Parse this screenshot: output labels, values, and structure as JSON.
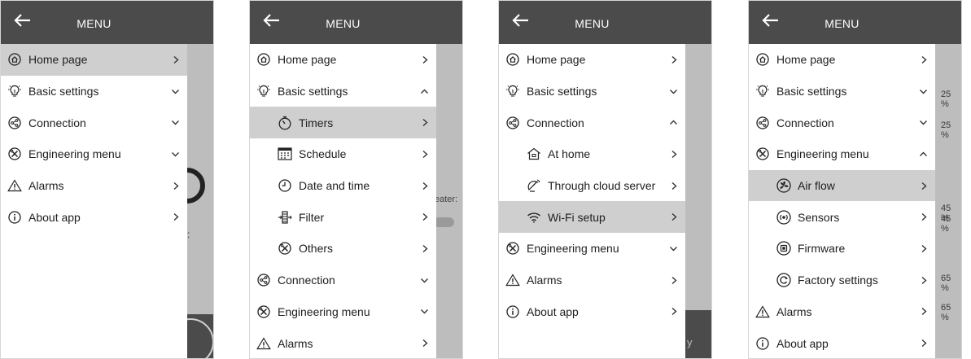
{
  "header": {
    "title": "MENU"
  },
  "panels": [
    {
      "items": [
        {
          "label": "Home page",
          "icon": "home-icon",
          "chev": ">",
          "hl": true
        },
        {
          "label": "Basic settings",
          "icon": "bulb-icon",
          "chev": "v"
        },
        {
          "label": "Connection",
          "icon": "share-icon",
          "chev": "v"
        },
        {
          "label": "Engineering menu",
          "icon": "tools-icon",
          "chev": "v"
        },
        {
          "label": "Alarms",
          "icon": "warning-icon",
          "chev": ">"
        },
        {
          "label": "About app",
          "icon": "info-icon",
          "chev": ">"
        }
      ],
      "behind_text": "r:"
    },
    {
      "items": [
        {
          "label": "Home page",
          "icon": "home-icon",
          "chev": ">"
        },
        {
          "label": "Basic settings",
          "icon": "bulb-icon",
          "chev": "^"
        },
        {
          "label": "Timers",
          "icon": "timer-icon",
          "chev": ">",
          "sub": true,
          "hl": true
        },
        {
          "label": "Schedule",
          "icon": "calendar-icon",
          "chev": ">",
          "sub": true
        },
        {
          "label": "Date and time",
          "icon": "clock-icon",
          "chev": ">",
          "sub": true
        },
        {
          "label": "Filter",
          "icon": "filter-icon",
          "chev": ">",
          "sub": true
        },
        {
          "label": "Others",
          "icon": "tools-icon",
          "chev": ">",
          "sub": true
        },
        {
          "label": "Connection",
          "icon": "share-icon",
          "chev": "v"
        },
        {
          "label": "Engineering menu",
          "icon": "tools-icon",
          "chev": "v"
        },
        {
          "label": "Alarms",
          "icon": "warning-icon",
          "chev": ">"
        }
      ],
      "behind_text": "eater:"
    },
    {
      "items": [
        {
          "label": "Home page",
          "icon": "home-icon",
          "chev": ">"
        },
        {
          "label": "Basic settings",
          "icon": "bulb-icon",
          "chev": "v"
        },
        {
          "label": "Connection",
          "icon": "share-icon",
          "chev": "^"
        },
        {
          "label": "At home",
          "icon": "house-icon",
          "chev": ">",
          "sub": true
        },
        {
          "label": "Through cloud server",
          "icon": "satellite-icon",
          "chev": ">",
          "sub": true
        },
        {
          "label": "Wi-Fi setup",
          "icon": "wifi-icon",
          "chev": ">",
          "sub": true,
          "hl": true
        },
        {
          "label": "Engineering menu",
          "icon": "tools-icon",
          "chev": "v"
        },
        {
          "label": "Alarms",
          "icon": "warning-icon",
          "chev": ">"
        },
        {
          "label": "About app",
          "icon": "info-icon",
          "chev": ">"
        }
      ],
      "behind_text": "y"
    },
    {
      "items": [
        {
          "label": "Home page",
          "icon": "home-icon",
          "chev": ">"
        },
        {
          "label": "Basic settings",
          "icon": "bulb-icon",
          "chev": "v"
        },
        {
          "label": "Connection",
          "icon": "share-icon",
          "chev": "v"
        },
        {
          "label": "Engineering menu",
          "icon": "tools-icon",
          "chev": "^"
        },
        {
          "label": "Air flow",
          "icon": "fan-icon",
          "chev": ">",
          "sub": true,
          "hl": true
        },
        {
          "label": "Sensors",
          "icon": "sensor-icon",
          "chev": ">",
          "sub": true
        },
        {
          "label": "Firmware",
          "icon": "chip-icon",
          "chev": ">",
          "sub": true
        },
        {
          "label": "Factory settings",
          "icon": "reset-icon",
          "chev": ">",
          "sub": true
        },
        {
          "label": "Alarms",
          "icon": "warning-icon",
          "chev": ">"
        },
        {
          "label": "About app",
          "icon": "info-icon",
          "chev": ">"
        }
      ],
      "behind_percentages": [
        "25 %",
        "25 %",
        "45 %",
        "45 %",
        "65 %",
        "65 %"
      ]
    }
  ]
}
